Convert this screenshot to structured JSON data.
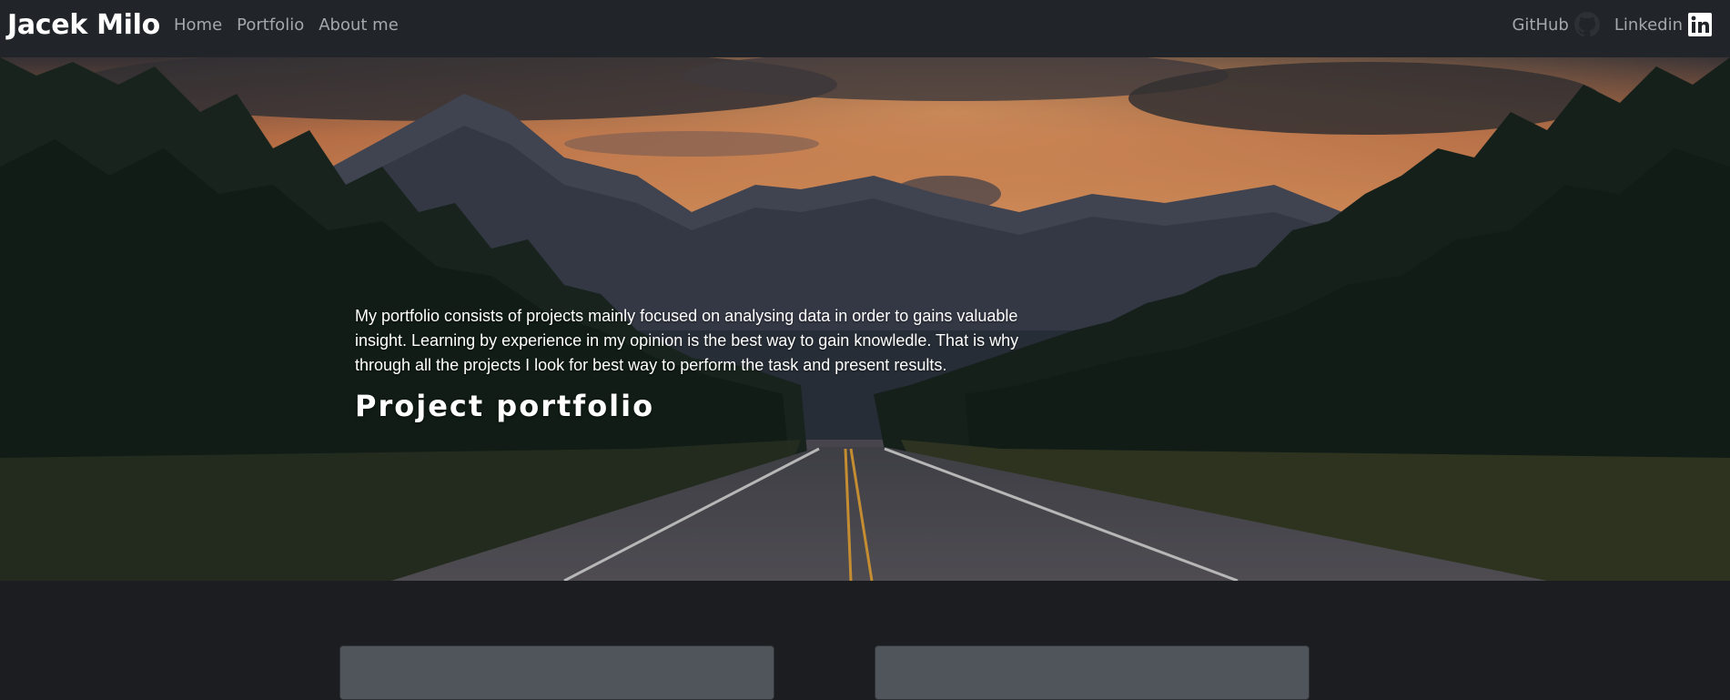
{
  "navbar": {
    "brand": "Jacek Milo",
    "links": [
      {
        "label": "Home"
      },
      {
        "label": "Portfolio"
      },
      {
        "label": "About me"
      }
    ],
    "external": [
      {
        "label": "GitHub",
        "icon": "github-icon"
      },
      {
        "label": "Linkedin",
        "icon": "linkedin-icon"
      }
    ]
  },
  "hero": {
    "background": "mountain road at sunset",
    "description": "My portfolio consists of projects mainly focused on analysing data in order to gains valuable insight. Learning by experience in my opinion is the best way to gain knowledle. That is why through all the projects I look for best way to perform the task and present results.",
    "title": "Project portfolio"
  },
  "colors": {
    "navbar_bg": "#212529",
    "page_bg": "#1b1d20",
    "nav_link": "#a3a8ad",
    "card_bg": "#4f555b"
  },
  "cards": [
    {
      "id": "card-1"
    },
    {
      "id": "card-2"
    }
  ]
}
